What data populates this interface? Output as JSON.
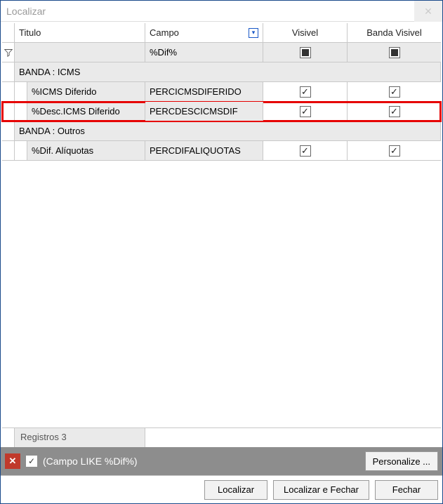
{
  "window": {
    "title": "Localizar"
  },
  "columns": {
    "titulo": "Titulo",
    "campo": "Campo",
    "visivel": "Visivel",
    "banda_visivel": "Banda Visivel"
  },
  "filter_row": {
    "campo_value": "%Dif%"
  },
  "groups": [
    {
      "label": "BANDA : ICMS",
      "rows": [
        {
          "titulo": "%ICMS Diferido",
          "campo": "PERCICMSDIFERIDO",
          "visivel": true,
          "banda_visivel": true,
          "highlight": false
        },
        {
          "titulo": "%Desc.ICMS Diferido",
          "campo": "PERCDESCICMSDIF",
          "visivel": true,
          "banda_visivel": true,
          "highlight": true
        }
      ]
    },
    {
      "label": "BANDA : Outros",
      "rows": [
        {
          "titulo": "%Dif. Alíquotas",
          "campo": "PERCDIFALIQUOTAS",
          "visivel": true,
          "banda_visivel": true,
          "highlight": false
        }
      ]
    }
  ],
  "status": {
    "text": "Registros 3"
  },
  "filterbar": {
    "expression": "(Campo LIKE %Dif%)",
    "personalize": "Personalize ..."
  },
  "buttons": {
    "localizar": "Localizar",
    "localizar_fechar": "Localizar e Fechar",
    "fechar": "Fechar"
  }
}
